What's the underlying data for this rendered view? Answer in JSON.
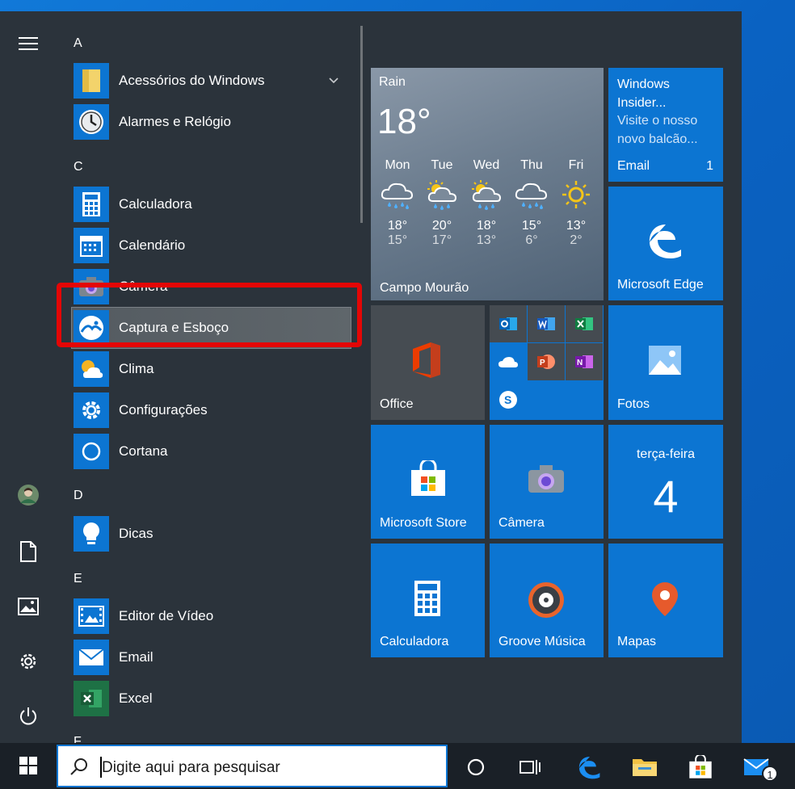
{
  "start_menu": {
    "app_list": {
      "groups": [
        {
          "letter": "A",
          "apps": [
            "Acessórios do Windows",
            "Alarmes e Relógio"
          ]
        },
        {
          "letter": "C",
          "apps": [
            "Calculadora",
            "Calendário",
            "Câmera",
            "Captura e Esboço",
            "Clima",
            "Configurações",
            "Cortana"
          ]
        },
        {
          "letter": "D",
          "apps": [
            "Dicas"
          ]
        },
        {
          "letter": "E",
          "apps": [
            "Editor de Vídeo",
            "Email",
            "Excel"
          ]
        },
        {
          "letter": "F",
          "apps": []
        }
      ],
      "selected_app": "Captura e Esboço",
      "highlight_color": "#e40606"
    },
    "rail_icons": [
      "hamburger-menu-icon",
      "user-avatar",
      "documents-icon",
      "pictures-icon",
      "settings-icon",
      "power-icon"
    ],
    "tiles": {
      "weather": {
        "condition": "Rain",
        "temperature": "18°",
        "location": "Campo Mourão",
        "forecast": [
          {
            "day": "Mon",
            "icon": "rain-icon",
            "high": "18°",
            "low": "15°"
          },
          {
            "day": "Tue",
            "icon": "sun-rain-icon",
            "high": "20°",
            "low": "17°"
          },
          {
            "day": "Wed",
            "icon": "sun-rain-icon",
            "high": "18°",
            "low": "13°"
          },
          {
            "day": "Thu",
            "icon": "rain-icon",
            "high": "15°",
            "low": "6°"
          },
          {
            "day": "Fri",
            "icon": "sun-icon",
            "high": "13°",
            "low": "2°"
          }
        ]
      },
      "email": {
        "title_line1": "Windows",
        "title_line2": "Insider...",
        "body_line1": "Visite o nosso",
        "body_line2": "novo balcão...",
        "label": "Email",
        "count": "1"
      },
      "edge": {
        "label": "Microsoft Edge"
      },
      "office": {
        "label": "Office"
      },
      "office_apps": [
        "outlook-icon",
        "word-icon",
        "excel-icon",
        "onedrive-icon",
        "powerpoint-icon",
        "onenote-icon",
        "skype-icon"
      ],
      "photos": {
        "label": "Fotos"
      },
      "store": {
        "label": "Microsoft Store"
      },
      "camera": {
        "label": "Câmera"
      },
      "calendar": {
        "weekday": "terça-feira",
        "day": "4"
      },
      "calculator": {
        "label": "Calculadora"
      },
      "groove": {
        "label": "Groove Música"
      },
      "maps": {
        "label": "Mapas"
      }
    }
  },
  "taskbar": {
    "search_placeholder": "Digite aqui para pesquisar",
    "mail_badge": "1",
    "icons": [
      "windows-start-icon",
      "search-icon",
      "cortana-icon",
      "task-view-icon",
      "edge-icon",
      "file-explorer-icon",
      "store-icon",
      "mail-icon"
    ]
  },
  "colors": {
    "accent": "#0c75d2",
    "start_bg": "#2b333b",
    "taskbar_bg": "#1a2027"
  }
}
